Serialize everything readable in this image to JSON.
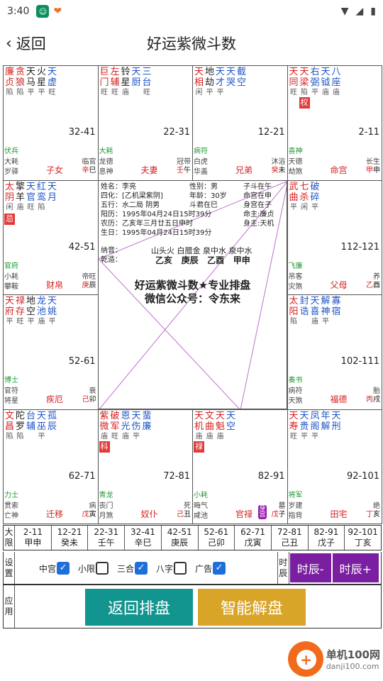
{
  "status_bar": {
    "time": "3:40"
  },
  "header": {
    "back_label": "返回",
    "title": "好运紫微斗数"
  },
  "palaces": [
    {
      "id": "si",
      "stars": [
        {
          "n": "廉",
          "b": "陷",
          "c": "red"
        },
        {
          "n": "贪",
          "b": "陷",
          "c": "red"
        },
        {
          "n": "天",
          "b": "平",
          "c": "black"
        },
        {
          "n": "火",
          "b": "平",
          "c": "black"
        },
        {
          "n": "天",
          "b": "旺",
          "c": "blue"
        }
      ],
      "stars2": [
        "贞",
        "狼",
        "马",
        "星",
        "虚"
      ],
      "range": "32-41",
      "m1": "伏兵",
      "m2": "大耗",
      "m2r": "临官",
      "m3": "岁驿",
      "palace": "子女",
      "stem": "辛巳"
    },
    {
      "id": "wu",
      "stars": [
        {
          "n": "巨",
          "b": "旺",
          "c": "red"
        },
        {
          "n": "左",
          "b": "旺",
          "c": "red"
        },
        {
          "n": "铃",
          "b": "庙",
          "c": "black"
        },
        {
          "n": "天",
          "b": "",
          "c": "blue"
        },
        {
          "n": "三",
          "b": "旺",
          "c": "blue"
        }
      ],
      "stars2": [
        "门",
        "辅",
        "星",
        "厨",
        "台"
      ],
      "range": "22-31",
      "m1": "大耗",
      "m2": "龙德",
      "m2r": "冠带",
      "m3": "息神",
      "palace": "夫妻",
      "stem": "壬午"
    },
    {
      "id": "wei",
      "stars": [
        {
          "n": "天",
          "b": "闲",
          "c": "red"
        },
        {
          "n": "地",
          "b": "平",
          "c": "black"
        },
        {
          "n": "天",
          "b": "平",
          "c": "blue"
        },
        {
          "n": "天",
          "b": "",
          "c": "blue"
        },
        {
          "n": "截",
          "b": "",
          "c": "blue"
        }
      ],
      "stars2": [
        "相",
        "劫",
        "才",
        "哭",
        "空"
      ],
      "range": "12-21",
      "m1": "病符",
      "m2": "白虎",
      "m2r": "沐浴",
      "m3": "华盖",
      "palace": "兄弟",
      "stem": "癸未"
    },
    {
      "id": "shen",
      "stars": [
        {
          "n": "天",
          "b": "旺",
          "c": "red"
        },
        {
          "n": "天",
          "b": "陷",
          "c": "red"
        },
        {
          "n": "右",
          "b": "平",
          "c": "blue"
        },
        {
          "n": "天",
          "b": "庙",
          "c": "blue"
        },
        {
          "n": "八",
          "b": "庙",
          "c": "blue"
        }
      ],
      "stars2": [
        "同",
        "梁",
        "弼",
        "钺",
        "座"
      ],
      "range": "2-11",
      "m1": "喜神",
      "m2": "天德",
      "m2r": "长生",
      "m3": "劫煞",
      "palace": "命宫",
      "stem": "甲申"
    },
    {
      "id": "chen",
      "stars": [
        {
          "n": "太",
          "b": "闲",
          "c": "red"
        },
        {
          "n": "擎",
          "b": "庙",
          "c": "black"
        },
        {
          "n": "天",
          "b": "旺",
          "c": "blue"
        },
        {
          "n": "红",
          "b": "陷",
          "c": "blue"
        },
        {
          "n": "天",
          "b": "",
          "c": "blue"
        }
      ],
      "stars2": [
        "阴",
        "羊",
        "官",
        "鸾",
        "月"
      ],
      "range": "42-51",
      "m1": "官府",
      "m2": "小耗",
      "m2r": "帝旺",
      "m3": "攀鞍",
      "palace": "财帛",
      "stem": "庚辰"
    },
    {
      "id": "you",
      "stars": [
        {
          "n": "武",
          "b": "平",
          "c": "red"
        },
        {
          "n": "七",
          "b": "闲",
          "c": "red"
        },
        {
          "n": "破",
          "b": "平",
          "c": "blue"
        }
      ],
      "stars2": [
        "曲",
        "杀",
        "碎"
      ],
      "range": "112-121",
      "m1": "飞廉",
      "m2": "吊客",
      "m2r": "养",
      "m3": "灾煞",
      "palace": "父母",
      "stem": "乙酉"
    },
    {
      "id": "mao",
      "stars": [
        {
          "n": "天",
          "b": "平",
          "c": "red"
        },
        {
          "n": "禄",
          "b": "旺",
          "c": "red"
        },
        {
          "n": "地",
          "b": "平",
          "c": "black"
        },
        {
          "n": "龙",
          "b": "庙",
          "c": "blue"
        },
        {
          "n": "天",
          "b": "平",
          "c": "blue"
        }
      ],
      "stars2": [
        "府",
        "存",
        "空",
        "池",
        "姚"
      ],
      "range": "52-61",
      "m1": "博士",
      "m2": "官符",
      "m2r": "衰",
      "m3": "将星",
      "palace": "疾厄",
      "stem": "己卯"
    },
    {
      "id": "xu",
      "stars": [
        {
          "n": "太",
          "b": "陷",
          "c": "red"
        },
        {
          "n": "封",
          "b": "",
          "c": "blue"
        },
        {
          "n": "天",
          "b": "庙",
          "c": "blue"
        },
        {
          "n": "解",
          "b": "平",
          "c": "blue"
        },
        {
          "n": "寡",
          "b": "",
          "c": "blue"
        }
      ],
      "stars2": [
        "阳",
        "诰",
        "喜",
        "神",
        "宿"
      ],
      "range": "102-111",
      "m1": "奏书",
      "m2": "病符",
      "m2r": "胎",
      "m3": "天煞",
      "palace": "福德",
      "stem": "丙戌"
    },
    {
      "id": "yin",
      "stars": [
        {
          "n": "文",
          "b": "陷",
          "c": "red"
        },
        {
          "n": "陀",
          "b": "陷",
          "c": "black"
        },
        {
          "n": "台",
          "b": "",
          "c": "blue"
        },
        {
          "n": "天",
          "b": "平",
          "c": "blue"
        },
        {
          "n": "孤",
          "b": "",
          "c": "blue"
        }
      ],
      "stars2": [
        "昌",
        "罗",
        "辅",
        "巫",
        "辰"
      ],
      "range": "62-71",
      "m1": "力士",
      "m2": "贯索",
      "m2r": "病",
      "m3": "亡神",
      "palace": "迁移",
      "stem": "戊寅"
    },
    {
      "id": "chou",
      "stars": [
        {
          "n": "紫",
          "b": "庙",
          "c": "red"
        },
        {
          "n": "破",
          "b": "旺",
          "c": "red"
        },
        {
          "n": "恩",
          "b": "庙",
          "c": "blue"
        },
        {
          "n": "天",
          "b": "平",
          "c": "blue"
        },
        {
          "n": "蜚",
          "b": "",
          "c": "blue"
        }
      ],
      "stars2": [
        "微",
        "军",
        "光",
        "伤",
        "廉"
      ],
      "range": "72-81",
      "m1": "青龙",
      "m2": "丧门",
      "m2r": "死",
      "m3": "月煞",
      "palace": "奴仆",
      "stem": "己丑"
    },
    {
      "id": "zi",
      "stars": [
        {
          "n": "天",
          "b": "庙",
          "c": "red"
        },
        {
          "n": "文",
          "b": "庙",
          "c": "red"
        },
        {
          "n": "天",
          "b": "庙",
          "c": "red"
        },
        {
          "n": "天",
          "b": "",
          "c": "blue"
        }
      ],
      "stars2": [
        "机",
        "曲",
        "魁",
        "空"
      ],
      "range": "82-91",
      "m1": "小耗",
      "m2": "晦气",
      "m2r": "墓",
      "m3": "咸池",
      "palace": "官禄",
      "stem": "戊子"
    },
    {
      "id": "hai",
      "stars": [
        {
          "n": "天",
          "b": "旺",
          "c": "red"
        },
        {
          "n": "天",
          "b": "平",
          "c": "blue"
        },
        {
          "n": "凤",
          "b": "平",
          "c": "blue"
        },
        {
          "n": "年",
          "b": "",
          "c": "blue"
        },
        {
          "n": "天",
          "b": "",
          "c": "blue"
        }
      ],
      "stars2": [
        "寿",
        "贵",
        "阁",
        "解",
        "刑"
      ],
      "range": "92-101",
      "m1": "将军",
      "m2": "岁建",
      "m2r": "绝",
      "m3": "指背",
      "palace": "田宅",
      "stem": "丁亥"
    }
  ],
  "hua_marks": {
    "si_fly": "",
    "shen": "权",
    "chen": "忌",
    "chou": "科",
    "zi": "禄",
    "zi_body": "身宫"
  },
  "center": {
    "name_label": "姓名：",
    "name": "李亮",
    "gender_label": "性别：",
    "gender": "男",
    "zidou_label": "子斗在午",
    "sihua_label": "四化：",
    "sihua": "[乙机梁紫阴]",
    "age_label": "年龄：",
    "age": "30岁",
    "ming_gong": "命宫在申",
    "wuxing_label": "五行：",
    "wuxing": "水二局 阴男",
    "doujun": "斗君在巳",
    "shen_gong": "身宫在子",
    "yangli_label": "阳历：",
    "yangli": "1995年04月24日15时39分",
    "ming_zhu": "命主:廉贞",
    "nongli_label": "农历：",
    "nongli": "乙亥年三月廿五日申时",
    "shen_zhu": "身主:天机",
    "shengri_label": "生日：",
    "shengri": "1995年04月24日15时39分",
    "nayin_label": "纳音：",
    "nayin": [
      "山头火",
      "白腊金",
      "泉中水",
      "泉中水"
    ],
    "qianzao_label": "乾造：",
    "qianzao": [
      "乙亥",
      "庚辰",
      "乙酉",
      "甲申"
    ],
    "ad_line1": "好运紫微斗数★专业排盘",
    "ad_line2": "微信公众号：令东来"
  },
  "decades": {
    "head": [
      "大",
      "限"
    ],
    "items": [
      [
        "2-11",
        "甲申"
      ],
      [
        "12-21",
        "癸未"
      ],
      [
        "22-31",
        "壬午"
      ],
      [
        "32-41",
        "辛巳"
      ],
      [
        "42-51",
        "庚辰"
      ],
      [
        "52-61",
        "己卯"
      ],
      [
        "62-71",
        "戊寅"
      ],
      [
        "72-81",
        "己丑"
      ],
      [
        "82-91",
        "戊子"
      ],
      [
        "92-101",
        "丁亥"
      ]
    ]
  },
  "settings": {
    "head": [
      "设",
      "置"
    ],
    "checks": [
      {
        "label": "中宫",
        "on": true
      },
      {
        "label": "小限",
        "on": false
      },
      {
        "label": "三合",
        "on": true
      },
      {
        "label": "八字",
        "on": false
      },
      {
        "label": "广告",
        "on": true
      }
    ],
    "shichen_head": [
      "时",
      "辰"
    ],
    "prev_label": "时辰-",
    "next_label": "时辰+"
  },
  "apply": {
    "head": [
      "应",
      "用"
    ],
    "back_chart": "返回排盘",
    "smart_read": "智能解盘",
    "back_color": "#12948f",
    "smart_color": "#d9a528"
  },
  "watermark": {
    "name": "单机100网",
    "url": "danji100.com"
  }
}
